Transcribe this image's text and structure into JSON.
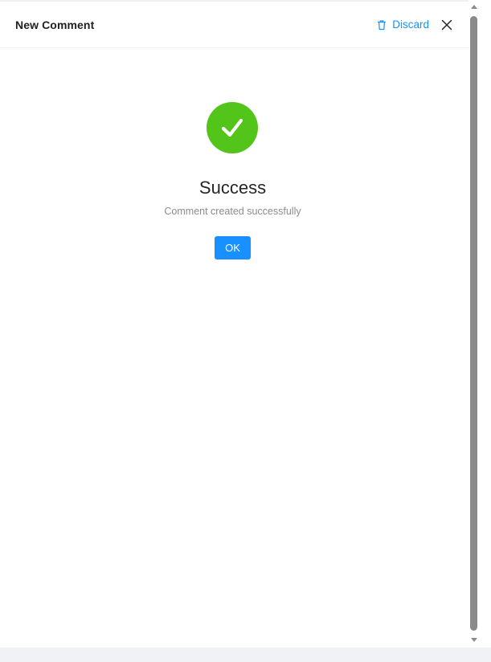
{
  "drawer": {
    "title": "New Comment",
    "discard_label": "Discard",
    "discard_icon": "trash-icon",
    "close_icon": "close-icon"
  },
  "result": {
    "status": "success",
    "icon": "check-circle-icon",
    "title": "Success",
    "subtitle": "Comment created successfully",
    "ok_label": "OK"
  },
  "colors": {
    "accent": "#1890ff",
    "success": "#52c41a"
  }
}
